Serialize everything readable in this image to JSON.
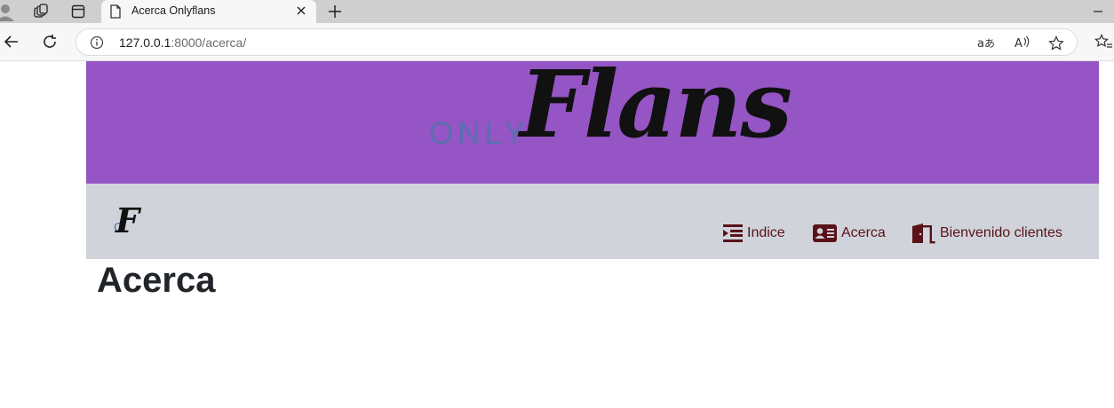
{
  "browser": {
    "tab": {
      "title": "Acerca Onlyflans"
    },
    "address": {
      "host": "127.0.0.1",
      "rest": ":8000/acerca/"
    }
  },
  "banner": {
    "logo_only": "ONLY",
    "logo_flans": "Flans"
  },
  "navbar": {
    "brand": {
      "o": "O",
      "f": "F"
    },
    "items": [
      {
        "label": "Indice",
        "icon": "indent-icon"
      },
      {
        "label": "Acerca",
        "icon": "id-card-icon"
      },
      {
        "label": "Bienvenido clientes",
        "icon": "door-open-icon"
      }
    ]
  },
  "main": {
    "title": "Acerca"
  },
  "colors": {
    "banner_bg": "#9555c5",
    "navbar_bg": "#d0d3da",
    "nav_link": "#5a1219",
    "logo_accent": "#5a6fb0"
  }
}
